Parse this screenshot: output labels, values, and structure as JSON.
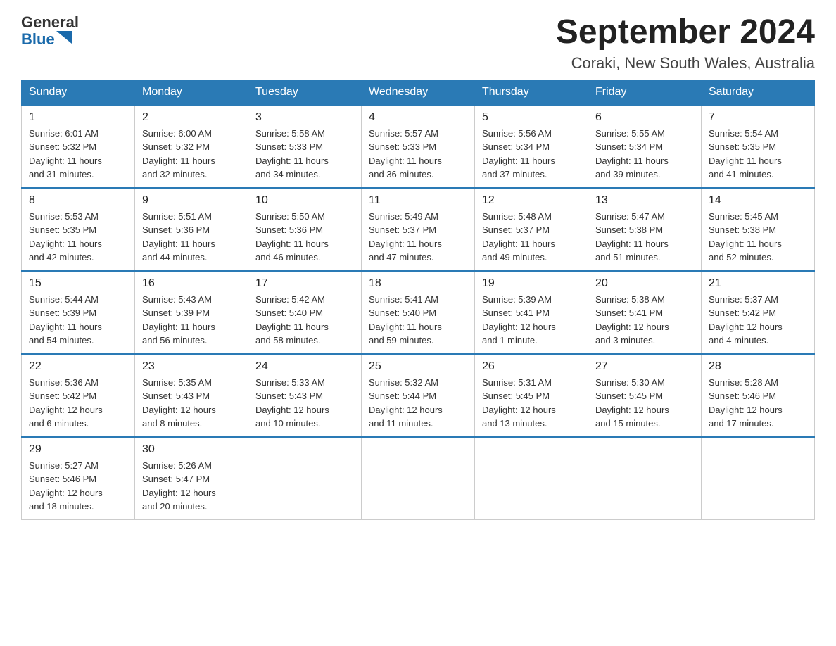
{
  "header": {
    "logo_general": "General",
    "logo_blue": "Blue",
    "calendar_title": "September 2024",
    "calendar_subtitle": "Coraki, New South Wales, Australia"
  },
  "days_of_week": [
    "Sunday",
    "Monday",
    "Tuesday",
    "Wednesday",
    "Thursday",
    "Friday",
    "Saturday"
  ],
  "weeks": [
    [
      {
        "day": "1",
        "info": "Sunrise: 6:01 AM\nSunset: 5:32 PM\nDaylight: 11 hours\nand 31 minutes."
      },
      {
        "day": "2",
        "info": "Sunrise: 6:00 AM\nSunset: 5:32 PM\nDaylight: 11 hours\nand 32 minutes."
      },
      {
        "day": "3",
        "info": "Sunrise: 5:58 AM\nSunset: 5:33 PM\nDaylight: 11 hours\nand 34 minutes."
      },
      {
        "day": "4",
        "info": "Sunrise: 5:57 AM\nSunset: 5:33 PM\nDaylight: 11 hours\nand 36 minutes."
      },
      {
        "day": "5",
        "info": "Sunrise: 5:56 AM\nSunset: 5:34 PM\nDaylight: 11 hours\nand 37 minutes."
      },
      {
        "day": "6",
        "info": "Sunrise: 5:55 AM\nSunset: 5:34 PM\nDaylight: 11 hours\nand 39 minutes."
      },
      {
        "day": "7",
        "info": "Sunrise: 5:54 AM\nSunset: 5:35 PM\nDaylight: 11 hours\nand 41 minutes."
      }
    ],
    [
      {
        "day": "8",
        "info": "Sunrise: 5:53 AM\nSunset: 5:35 PM\nDaylight: 11 hours\nand 42 minutes."
      },
      {
        "day": "9",
        "info": "Sunrise: 5:51 AM\nSunset: 5:36 PM\nDaylight: 11 hours\nand 44 minutes."
      },
      {
        "day": "10",
        "info": "Sunrise: 5:50 AM\nSunset: 5:36 PM\nDaylight: 11 hours\nand 46 minutes."
      },
      {
        "day": "11",
        "info": "Sunrise: 5:49 AM\nSunset: 5:37 PM\nDaylight: 11 hours\nand 47 minutes."
      },
      {
        "day": "12",
        "info": "Sunrise: 5:48 AM\nSunset: 5:37 PM\nDaylight: 11 hours\nand 49 minutes."
      },
      {
        "day": "13",
        "info": "Sunrise: 5:47 AM\nSunset: 5:38 PM\nDaylight: 11 hours\nand 51 minutes."
      },
      {
        "day": "14",
        "info": "Sunrise: 5:45 AM\nSunset: 5:38 PM\nDaylight: 11 hours\nand 52 minutes."
      }
    ],
    [
      {
        "day": "15",
        "info": "Sunrise: 5:44 AM\nSunset: 5:39 PM\nDaylight: 11 hours\nand 54 minutes."
      },
      {
        "day": "16",
        "info": "Sunrise: 5:43 AM\nSunset: 5:39 PM\nDaylight: 11 hours\nand 56 minutes."
      },
      {
        "day": "17",
        "info": "Sunrise: 5:42 AM\nSunset: 5:40 PM\nDaylight: 11 hours\nand 58 minutes."
      },
      {
        "day": "18",
        "info": "Sunrise: 5:41 AM\nSunset: 5:40 PM\nDaylight: 11 hours\nand 59 minutes."
      },
      {
        "day": "19",
        "info": "Sunrise: 5:39 AM\nSunset: 5:41 PM\nDaylight: 12 hours\nand 1 minute."
      },
      {
        "day": "20",
        "info": "Sunrise: 5:38 AM\nSunset: 5:41 PM\nDaylight: 12 hours\nand 3 minutes."
      },
      {
        "day": "21",
        "info": "Sunrise: 5:37 AM\nSunset: 5:42 PM\nDaylight: 12 hours\nand 4 minutes."
      }
    ],
    [
      {
        "day": "22",
        "info": "Sunrise: 5:36 AM\nSunset: 5:42 PM\nDaylight: 12 hours\nand 6 minutes."
      },
      {
        "day": "23",
        "info": "Sunrise: 5:35 AM\nSunset: 5:43 PM\nDaylight: 12 hours\nand 8 minutes."
      },
      {
        "day": "24",
        "info": "Sunrise: 5:33 AM\nSunset: 5:43 PM\nDaylight: 12 hours\nand 10 minutes."
      },
      {
        "day": "25",
        "info": "Sunrise: 5:32 AM\nSunset: 5:44 PM\nDaylight: 12 hours\nand 11 minutes."
      },
      {
        "day": "26",
        "info": "Sunrise: 5:31 AM\nSunset: 5:45 PM\nDaylight: 12 hours\nand 13 minutes."
      },
      {
        "day": "27",
        "info": "Sunrise: 5:30 AM\nSunset: 5:45 PM\nDaylight: 12 hours\nand 15 minutes."
      },
      {
        "day": "28",
        "info": "Sunrise: 5:28 AM\nSunset: 5:46 PM\nDaylight: 12 hours\nand 17 minutes."
      }
    ],
    [
      {
        "day": "29",
        "info": "Sunrise: 5:27 AM\nSunset: 5:46 PM\nDaylight: 12 hours\nand 18 minutes."
      },
      {
        "day": "30",
        "info": "Sunrise: 5:26 AM\nSunset: 5:47 PM\nDaylight: 12 hours\nand 20 minutes."
      },
      {
        "day": "",
        "info": ""
      },
      {
        "day": "",
        "info": ""
      },
      {
        "day": "",
        "info": ""
      },
      {
        "day": "",
        "info": ""
      },
      {
        "day": "",
        "info": ""
      }
    ]
  ]
}
